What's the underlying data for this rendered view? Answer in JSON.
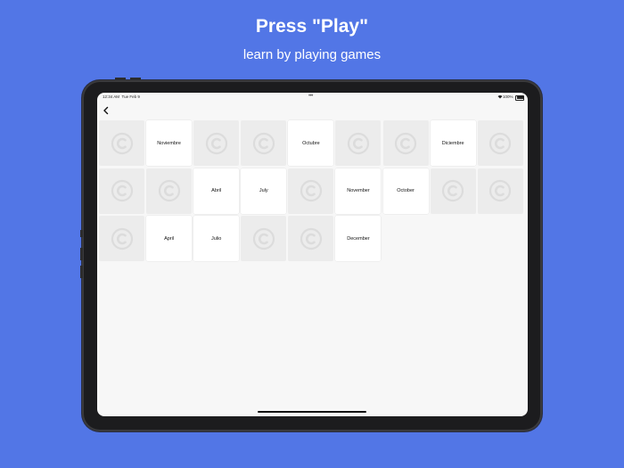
{
  "promo": {
    "title": "Press \"Play\"",
    "subtitle": "learn by playing games"
  },
  "status_bar": {
    "time": "12:34 AM",
    "date": "Tue Feb 9",
    "battery": "100%"
  },
  "nav": {
    "back_icon": "chevron-left-icon"
  },
  "game": {
    "card_back_icon": "copyright-circle-icon",
    "cards": [
      {
        "face": "back",
        "label": ""
      },
      {
        "face": "front",
        "label": "Noviembre"
      },
      {
        "face": "back",
        "label": ""
      },
      {
        "face": "back",
        "label": ""
      },
      {
        "face": "front",
        "label": "Octubre"
      },
      {
        "face": "back",
        "label": ""
      },
      {
        "face": "back",
        "label": ""
      },
      {
        "face": "front",
        "label": "Diciembre"
      },
      {
        "face": "back",
        "label": ""
      },
      {
        "face": "back",
        "label": ""
      },
      {
        "face": "back",
        "label": ""
      },
      {
        "face": "front",
        "label": "Abril"
      },
      {
        "face": "front",
        "label": "July"
      },
      {
        "face": "back",
        "label": ""
      },
      {
        "face": "front",
        "label": "November"
      },
      {
        "face": "front",
        "label": "October"
      },
      {
        "face": "back",
        "label": ""
      },
      {
        "face": "back",
        "label": ""
      },
      {
        "face": "back",
        "label": ""
      },
      {
        "face": "front",
        "label": "April"
      },
      {
        "face": "front",
        "label": "Julio"
      },
      {
        "face": "back",
        "label": ""
      },
      {
        "face": "back",
        "label": ""
      },
      {
        "face": "front",
        "label": "December"
      }
    ]
  },
  "colors": {
    "background": "#5276e6",
    "screen": "#f7f7f7",
    "card_back": "#ececec",
    "card_front": "#ffffff",
    "card_icon": "#dcdcdc"
  }
}
